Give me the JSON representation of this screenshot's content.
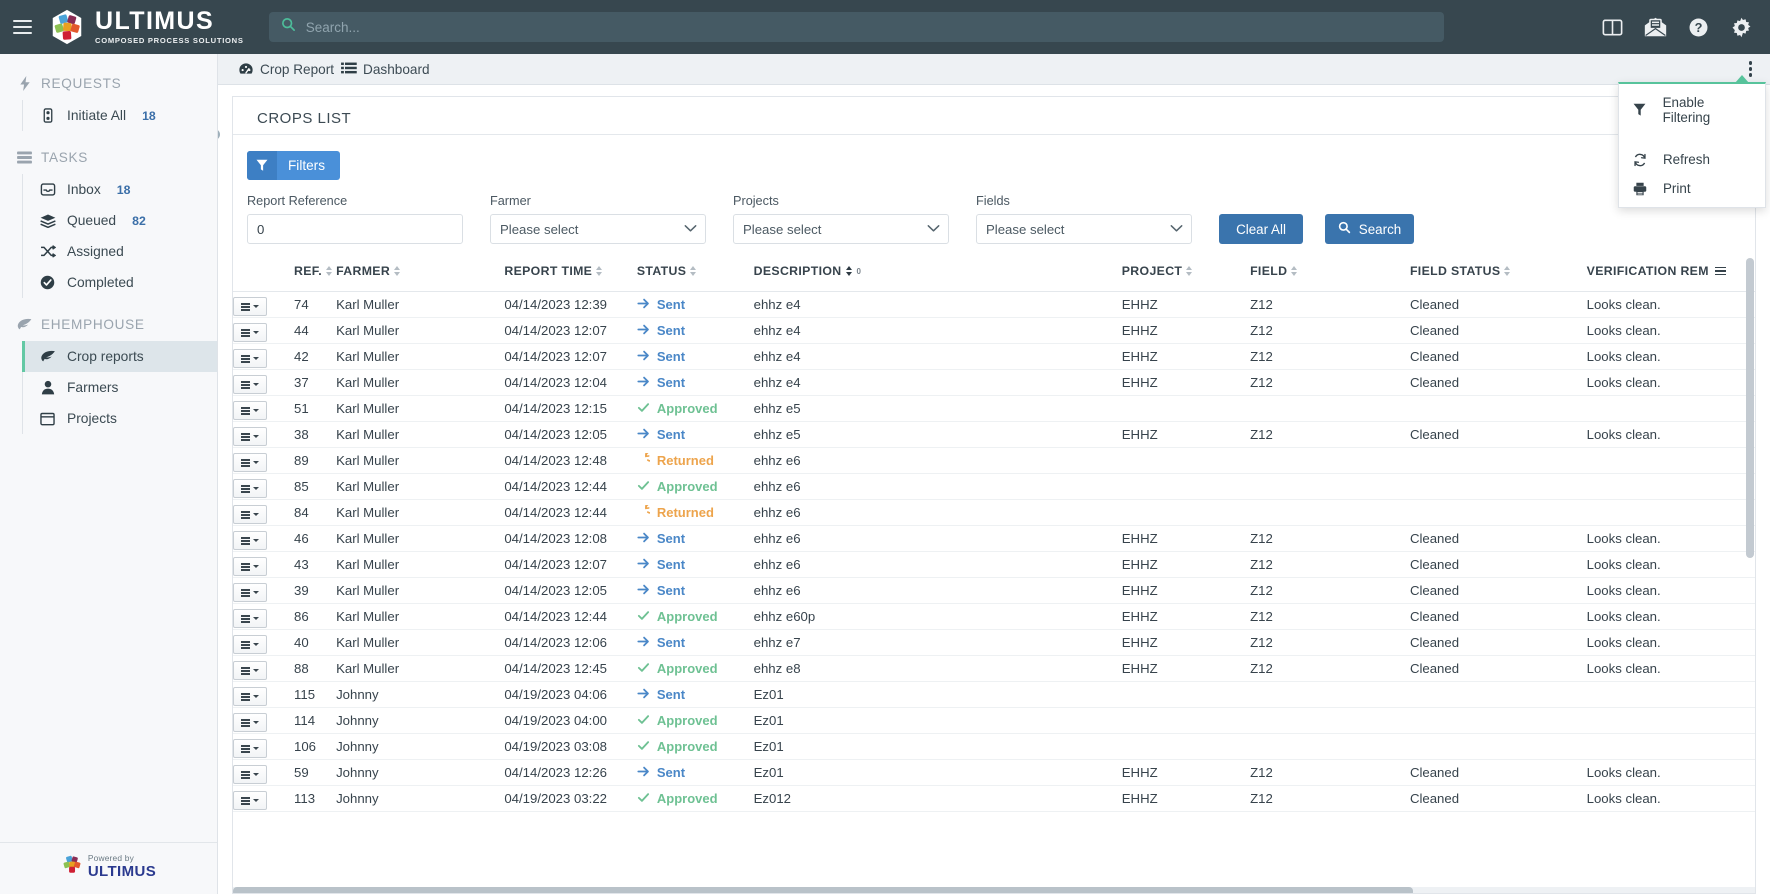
{
  "topbar": {
    "brand_name": "ULTIMUS",
    "brand_tagline": "COMPOSED PROCESS SOLUTIONS",
    "search_placeholder": "Search...",
    "search_value": "",
    "icons": [
      "panel-layout-icon",
      "mail-icon",
      "help-icon",
      "gear-icon"
    ]
  },
  "sidebar": {
    "sections": [
      {
        "title": "REQUESTS",
        "icon": "bolt-icon",
        "items": [
          {
            "label": "Initiate All",
            "icon": "traffic-light-icon",
            "badge": "18",
            "active": false
          }
        ]
      },
      {
        "title": "TASKS",
        "icon": "stack-icon",
        "items": [
          {
            "label": "Inbox",
            "icon": "inbox-icon",
            "badge": "18",
            "active": false
          },
          {
            "label": "Queued",
            "icon": "layers-icon",
            "badge": "82",
            "active": false
          },
          {
            "label": "Assigned",
            "icon": "shuffle-icon",
            "badge": "",
            "active": false
          },
          {
            "label": "Completed",
            "icon": "check-circle-icon",
            "badge": "",
            "active": false
          }
        ]
      },
      {
        "title": "EHEMPHOUSE",
        "icon": "leaf-icon",
        "items": [
          {
            "label": "Crop reports",
            "icon": "leaf-icon",
            "badge": "",
            "active": true
          },
          {
            "label": "Farmers",
            "icon": "user-icon",
            "badge": "",
            "active": false
          },
          {
            "label": "Projects",
            "icon": "window-icon",
            "badge": "",
            "active": false
          }
        ]
      }
    ],
    "footer": {
      "powered_by": "Powered by",
      "brand": "ULTIMUS"
    }
  },
  "breadcrumb": {
    "items": [
      {
        "label": "Crop Report",
        "icon": "speedometer-icon"
      },
      {
        "label": "Dashboard",
        "icon": "list-icon"
      }
    ],
    "kebab": "more-options-icon"
  },
  "context_menu": {
    "visible": true,
    "items": [
      {
        "label": "Enable Filtering",
        "icon": "funnel-icon"
      },
      {
        "label": "Refresh",
        "icon": "refresh-icon"
      },
      {
        "label": "Print",
        "icon": "printer-icon"
      }
    ]
  },
  "card": {
    "title": "CROPS LIST"
  },
  "filters": {
    "toggle_label": "Filters",
    "toggle_icon": "funnel-icon",
    "fields": [
      {
        "label": "Report Reference",
        "type": "text",
        "value": "0",
        "placeholder": ""
      },
      {
        "label": "Farmer",
        "type": "select",
        "value": "Please select"
      },
      {
        "label": "Projects",
        "type": "select",
        "value": "Please select"
      },
      {
        "label": "Fields",
        "type": "select",
        "value": "Please select"
      }
    ],
    "clear_label": "Clear All",
    "search_label": "Search",
    "search_icon": "search-icon"
  },
  "table": {
    "columns": [
      {
        "key": "actions",
        "label": "",
        "sortable": false
      },
      {
        "key": "ref",
        "label": "REF.",
        "sortable": true,
        "sorted": false
      },
      {
        "key": "farmer",
        "label": "FARMER",
        "sortable": true,
        "sorted": false
      },
      {
        "key": "report_time",
        "label": "REPORT TIME",
        "sortable": true,
        "sorted": false
      },
      {
        "key": "status",
        "label": "STATUS",
        "sortable": true,
        "sorted": false
      },
      {
        "key": "description",
        "label": "DESCRIPTION",
        "sortable": true,
        "sorted": true,
        "sort_order": "0"
      },
      {
        "key": "project",
        "label": "PROJECT",
        "sortable": true,
        "sorted": false
      },
      {
        "key": "field",
        "label": "FIELD",
        "sortable": true,
        "sorted": false
      },
      {
        "key": "field_status",
        "label": "FIELD STATUS",
        "sortable": true,
        "sorted": false
      },
      {
        "key": "verification",
        "label": "VERIFICATION REM",
        "sortable": false,
        "sorted": false,
        "has_col_menu": true
      }
    ],
    "row_action_icon": "row-menu-icon",
    "rows": [
      {
        "ref": "74",
        "farmer": "Karl Muller",
        "report_time": "04/14/2023 12:39",
        "status": "Sent",
        "description": "ehhz e4",
        "project": "EHHZ",
        "field": "Z12",
        "field_status": "Cleaned",
        "verification": "Looks clean."
      },
      {
        "ref": "44",
        "farmer": "Karl Muller",
        "report_time": "04/14/2023 12:07",
        "status": "Sent",
        "description": "ehhz e4",
        "project": "EHHZ",
        "field": "Z12",
        "field_status": "Cleaned",
        "verification": "Looks clean."
      },
      {
        "ref": "42",
        "farmer": "Karl Muller",
        "report_time": "04/14/2023 12:07",
        "status": "Sent",
        "description": "ehhz e4",
        "project": "EHHZ",
        "field": "Z12",
        "field_status": "Cleaned",
        "verification": "Looks clean."
      },
      {
        "ref": "37",
        "farmer": "Karl Muller",
        "report_time": "04/14/2023 12:04",
        "status": "Sent",
        "description": "ehhz e4",
        "project": "EHHZ",
        "field": "Z12",
        "field_status": "Cleaned",
        "verification": "Looks clean."
      },
      {
        "ref": "51",
        "farmer": "Karl Muller",
        "report_time": "04/14/2023 12:15",
        "status": "Approved",
        "description": "ehhz e5",
        "project": "",
        "field": "",
        "field_status": "",
        "verification": ""
      },
      {
        "ref": "38",
        "farmer": "Karl Muller",
        "report_time": "04/14/2023 12:05",
        "status": "Sent",
        "description": "ehhz e5",
        "project": "EHHZ",
        "field": "Z12",
        "field_status": "Cleaned",
        "verification": "Looks clean."
      },
      {
        "ref": "89",
        "farmer": "Karl Muller",
        "report_time": "04/14/2023 12:48",
        "status": "Returned",
        "description": "ehhz e6",
        "project": "",
        "field": "",
        "field_status": "",
        "verification": ""
      },
      {
        "ref": "85",
        "farmer": "Karl Muller",
        "report_time": "04/14/2023 12:44",
        "status": "Approved",
        "description": "ehhz e6",
        "project": "",
        "field": "",
        "field_status": "",
        "verification": ""
      },
      {
        "ref": "84",
        "farmer": "Karl Muller",
        "report_time": "04/14/2023 12:44",
        "status": "Returned",
        "description": "ehhz e6",
        "project": "",
        "field": "",
        "field_status": "",
        "verification": ""
      },
      {
        "ref": "46",
        "farmer": "Karl Muller",
        "report_time": "04/14/2023 12:08",
        "status": "Sent",
        "description": "ehhz e6",
        "project": "EHHZ",
        "field": "Z12",
        "field_status": "Cleaned",
        "verification": "Looks clean."
      },
      {
        "ref": "43",
        "farmer": "Karl Muller",
        "report_time": "04/14/2023 12:07",
        "status": "Sent",
        "description": "ehhz e6",
        "project": "EHHZ",
        "field": "Z12",
        "field_status": "Cleaned",
        "verification": "Looks clean."
      },
      {
        "ref": "39",
        "farmer": "Karl Muller",
        "report_time": "04/14/2023 12:05",
        "status": "Sent",
        "description": "ehhz e6",
        "project": "EHHZ",
        "field": "Z12",
        "field_status": "Cleaned",
        "verification": "Looks clean."
      },
      {
        "ref": "86",
        "farmer": "Karl Muller",
        "report_time": "04/14/2023 12:44",
        "status": "Approved",
        "description": "ehhz e60p",
        "project": "EHHZ",
        "field": "Z12",
        "field_status": "Cleaned",
        "verification": "Looks clean."
      },
      {
        "ref": "40",
        "farmer": "Karl Muller",
        "report_time": "04/14/2023 12:06",
        "status": "Sent",
        "description": "ehhz e7",
        "project": "EHHZ",
        "field": "Z12",
        "field_status": "Cleaned",
        "verification": "Looks clean."
      },
      {
        "ref": "88",
        "farmer": "Karl Muller",
        "report_time": "04/14/2023 12:45",
        "status": "Approved",
        "description": "ehhz e8",
        "project": "EHHZ",
        "field": "Z12",
        "field_status": "Cleaned",
        "verification": "Looks clean."
      },
      {
        "ref": "115",
        "farmer": "Johnny",
        "report_time": "04/19/2023 04:06",
        "status": "Sent",
        "description": "Ez01",
        "project": "",
        "field": "",
        "field_status": "",
        "verification": ""
      },
      {
        "ref": "114",
        "farmer": "Johnny",
        "report_time": "04/19/2023 04:00",
        "status": "Approved",
        "description": "Ez01",
        "project": "",
        "field": "",
        "field_status": "",
        "verification": ""
      },
      {
        "ref": "106",
        "farmer": "Johnny",
        "report_time": "04/19/2023 03:08",
        "status": "Approved",
        "description": "Ez01",
        "project": "",
        "field": "",
        "field_status": "",
        "verification": ""
      },
      {
        "ref": "59",
        "farmer": "Johnny",
        "report_time": "04/14/2023 12:26",
        "status": "Sent",
        "description": "Ez01",
        "project": "EHHZ",
        "field": "Z12",
        "field_status": "Cleaned",
        "verification": "Looks clean."
      },
      {
        "ref": "113",
        "farmer": "Johnny",
        "report_time": "04/19/2023 03:22",
        "status": "Approved",
        "description": "Ez012",
        "project": "EHHZ",
        "field": "Z12",
        "field_status": "Cleaned",
        "verification": "Looks clean."
      }
    ]
  },
  "colors": {
    "topbar_bg": "#37474f",
    "accent_green": "#57c39b",
    "primary_blue": "#3a74ad",
    "filters_blue": "#4a90d9",
    "status_sent": "#4a87c7",
    "status_approved": "#6ec193",
    "status_returned": "#eda44c"
  }
}
